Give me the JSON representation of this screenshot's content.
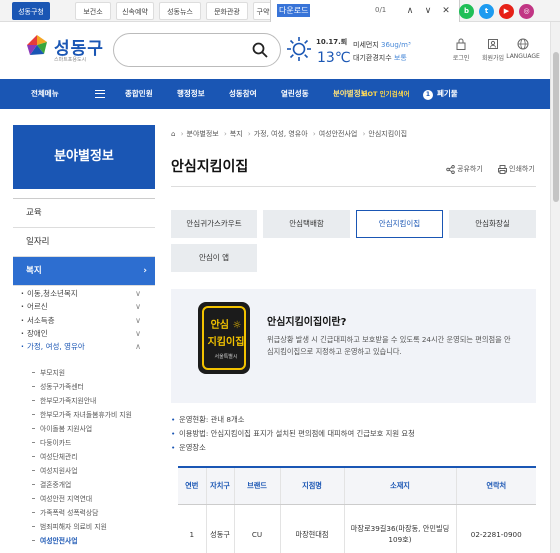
{
  "topbar": {
    "tabs": [
      "성동구청",
      "보건소",
      "신속예약",
      "성동뉴스",
      "문화관광",
      "구약"
    ],
    "find": {
      "query": "다운로드",
      "count": "0/1"
    },
    "sns": [
      {
        "name": "blog",
        "letter": "b",
        "color": "#1fbf57"
      },
      {
        "name": "twitter",
        "letter": "t",
        "color": "#1d9bf0"
      },
      {
        "name": "youtube",
        "letter": "▶",
        "color": "#e62117"
      },
      {
        "name": "instagram",
        "letter": "◎",
        "color": "#c13584"
      }
    ]
  },
  "header": {
    "logo": "성동구",
    "logo_sub": "스마트포용도시",
    "search_placeholder": "",
    "date": "10.17.퇴",
    "temp": "13℃",
    "dust1_label": "미세먼지",
    "dust1_value": "36ug/m³",
    "dust2_label": "대기환경지수",
    "dust2_value": "보통",
    "utils": [
      {
        "label": "로그인",
        "icon": "lock-icon"
      },
      {
        "label": "회원가입",
        "icon": "user-icon"
      },
      {
        "label": "LANGUAGE",
        "icon": "globe-icon"
      }
    ]
  },
  "nav": {
    "all_menu": "전체메뉴",
    "items": [
      "종합민원",
      "행정정보",
      "성동참여",
      "열린성동",
      "분야별정보"
    ],
    "hot_label": "HOT 인기검색어",
    "hot_num": "1",
    "hot_word": "폐기물"
  },
  "sidebar": {
    "title": "분야별정보",
    "items": [
      "교육",
      "일자리",
      "복지"
    ],
    "sub": [
      "이동,청소년복지",
      "어르신",
      "서소득층",
      "장애인",
      "가정, 여성, 영유아"
    ],
    "sub3": [
      "부모지원",
      "성동구가족센터",
      "한부모가족지원안내",
      "한부모가족 자녀돌봄휴가비 지원",
      "아이돌봄 지원사업",
      "다둥이카드",
      "여성단체관리",
      "여성지원사업",
      "결혼중개업",
      "여성안전 지역연대",
      "가족폭력 성폭력상담",
      "범죄피해자 의료비 지원",
      "여성안전사업"
    ]
  },
  "content": {
    "breadcrumb": [
      "분야별정보",
      "복지",
      "가정, 여성, 영유아",
      "여성안전사업",
      "안심지킴이집"
    ],
    "title": "안심지킴이집",
    "share": "공유하기",
    "print": "인쇄하기",
    "tabs": [
      "안심귀가스카우트",
      "안심택배함",
      "안심지킴이집",
      "안심화장실",
      "안심이 앱"
    ],
    "badge": {
      "line1": "안심 ☼",
      "line2": "지킴이집",
      "line3": "서울특별시"
    },
    "intro_title": "안심지킴이집이란?",
    "intro_desc": "위급상황 발생 시 긴급대피하고 보호받을 수 있도록 24시간 운영되는 편의점을 안심지킴이집으로 지정하고 운영하고 있습니다.",
    "bullets": [
      "운영현황: 관내 8개소",
      "이용방법: 안심지킴이집 표지가 설치된 편의점에 대피하여 긴급보호 지원 요청",
      "운영장소"
    ],
    "table": {
      "headers": [
        "연번",
        "자치구",
        "브랜드",
        "지점명",
        "소재지",
        "연락처"
      ],
      "rows": [
        [
          "1",
          "성동구",
          "CU",
          "마장현대점",
          "마장로39길36(마장동, 안민빌딩109호)",
          "02-2281-0900"
        ]
      ]
    }
  }
}
